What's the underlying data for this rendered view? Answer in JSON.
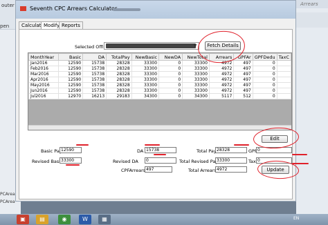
{
  "background": {
    "left_texts": [
      "outer",
      "pen",
      "PCArea",
      "PCArea"
    ],
    "right_search": "Arrears"
  },
  "window": {
    "title": "Seventh CPC Arrears Calculator",
    "tabs": [
      "Calculate",
      "Modify",
      "Reports"
    ],
    "active_tab": 1
  },
  "office": {
    "label": "Selected Office"
  },
  "buttons": {
    "fetch": "Fetch Details",
    "edit": "Edit",
    "update": "Update"
  },
  "grid": {
    "columns": [
      "MonthYear",
      "Basic",
      "DA",
      "TotalPay",
      "NewBasic",
      "NewDA",
      "NewTotal",
      "Arrears",
      "GPFAr",
      "GPFDedu",
      "TaxC"
    ],
    "rows": [
      [
        "Jan2016",
        "12590",
        "15738",
        "28328",
        "33300",
        "0",
        "33300",
        "4972",
        "497",
        "0",
        ""
      ],
      [
        "Feb2016",
        "12590",
        "15738",
        "28328",
        "33300",
        "0",
        "33300",
        "4972",
        "497",
        "0",
        ""
      ],
      [
        "Mar2016",
        "12590",
        "15738",
        "28328",
        "33300",
        "0",
        "33300",
        "4972",
        "497",
        "0",
        ""
      ],
      [
        "Apr2016",
        "12590",
        "15738",
        "28328",
        "33300",
        "0",
        "33300",
        "4972",
        "497",
        "0",
        ""
      ],
      [
        "May2016",
        "12590",
        "15738",
        "28328",
        "33300",
        "0",
        "33300",
        "4972",
        "497",
        "0",
        ""
      ],
      [
        "Jun2016",
        "12590",
        "15738",
        "28328",
        "33300",
        "0",
        "33300",
        "4972",
        "497",
        "0",
        ""
      ],
      [
        "Jul2016",
        "12970",
        "16213",
        "29183",
        "34300",
        "0",
        "34300",
        "5117",
        "512",
        "0",
        ""
      ]
    ]
  },
  "form": {
    "basic_pay_label": "Basic Pay",
    "basic_pay": "12590",
    "revised_basic_label": "Revised Basic",
    "revised_basic": "33300",
    "da_label": "DA",
    "da": "15738",
    "revised_da_label": "Revised DA",
    "revised_da": "0",
    "cpf_arrears_label": "CPFArrears",
    "cpf_arrears": "497",
    "total_pay_label": "Total Pay",
    "total_pay": "28328",
    "total_revised_pay_label": "Total Revised Pay",
    "total_revised_pay": "33300",
    "total_arrears_label": "Total Arrears",
    "total_arrears": "4972",
    "gpf_label": "GPF",
    "gpf": "0",
    "tax_label": "Tax",
    "tax": "0"
  },
  "taskbar": {
    "language": "EN"
  },
  "colors": {
    "annotation": "#e0202a",
    "titlebar": "#c9d8ea"
  }
}
